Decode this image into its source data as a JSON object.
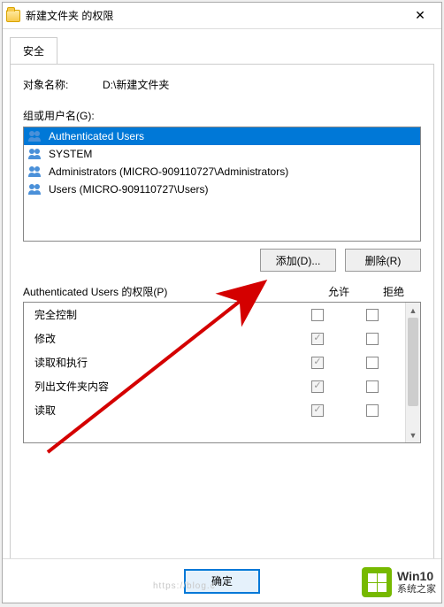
{
  "window": {
    "title": "新建文件夹 的权限"
  },
  "tab": {
    "security": "安全"
  },
  "object": {
    "label": "对象名称:",
    "value": "D:\\新建文件夹"
  },
  "groups": {
    "label": "组或用户名(G):",
    "items": [
      {
        "name": "Authenticated Users",
        "selected": true
      },
      {
        "name": "SYSTEM",
        "selected": false
      },
      {
        "name": "Administrators (MICRO-909110727\\Administrators)",
        "selected": false
      },
      {
        "name": "Users (MICRO-909110727\\Users)",
        "selected": false
      }
    ]
  },
  "buttons": {
    "add": "添加(D)...",
    "remove": "删除(R)",
    "ok": "确定"
  },
  "permissions": {
    "header_name": "Authenticated Users 的权限(P)",
    "col_allow": "允许",
    "col_deny": "拒绝",
    "rows": [
      {
        "name": "完全控制",
        "allow": false,
        "deny": false,
        "disabled": false
      },
      {
        "name": "修改",
        "allow": true,
        "deny": false,
        "disabled": true
      },
      {
        "name": "读取和执行",
        "allow": true,
        "deny": false,
        "disabled": true
      },
      {
        "name": "列出文件夹内容",
        "allow": true,
        "deny": false,
        "disabled": true
      },
      {
        "name": "读取",
        "allow": true,
        "deny": false,
        "disabled": true
      }
    ]
  },
  "watermark": {
    "line1": "Win10",
    "line2": "系统之家"
  },
  "faint_text": "https://blog.c"
}
